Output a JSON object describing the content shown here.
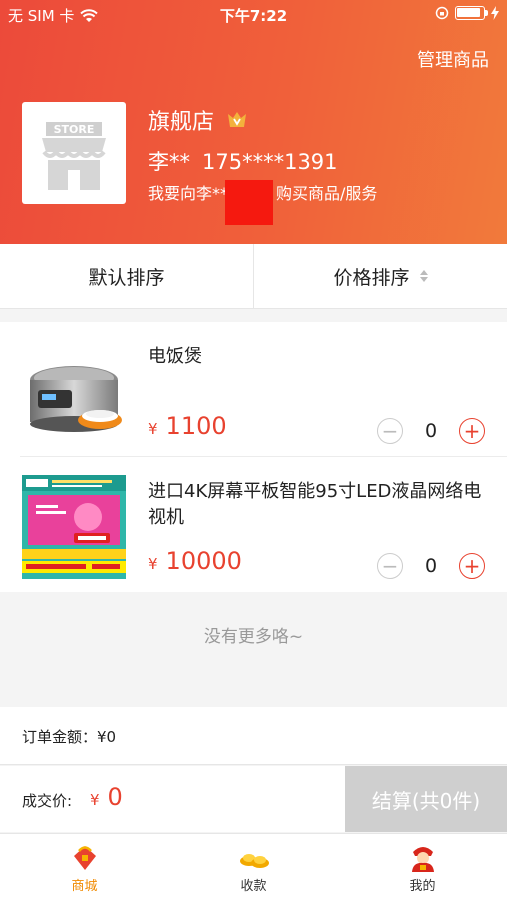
{
  "status_bar": {
    "carrier": "无 SIM 卡",
    "time": "下午7:22",
    "battery_level": 0.9
  },
  "header": {
    "manage_label": "管理商品",
    "store_icon_text": "STORE",
    "shop_name": "旗舰店",
    "owner_name": "李**",
    "owner_phone": "175****1391",
    "prompt_text": "我要向李**付款，购买商品/服务"
  },
  "sort": {
    "default_label": "默认排序",
    "price_label": "价格排序"
  },
  "products": [
    {
      "name": "电饭煲",
      "currency": "¥",
      "price": "1100",
      "quantity": "0"
    },
    {
      "name": "进口4K屏幕平板智能95寸LED液晶网络电视机",
      "currency": "¥",
      "price": "10000",
      "quantity": "0"
    }
  ],
  "no_more_text": "没有更多咯~",
  "order": {
    "amount_label": "订单金额：¥0",
    "deal_label": "成交价:",
    "deal_currency": "¥",
    "deal_price": "0",
    "checkout_label": "结算(共0件)"
  },
  "tabs": [
    {
      "label": "商城",
      "icon": "mall-icon",
      "active": true
    },
    {
      "label": "收款",
      "icon": "gold-ingot-icon",
      "active": false
    },
    {
      "label": "我的",
      "icon": "profile-icon",
      "active": false
    }
  ],
  "colors": {
    "accent": "#e8422f",
    "header_gradient_start": "#ec4a3a",
    "header_gradient_end": "#f17a3b",
    "active_tab": "#f08a00"
  }
}
